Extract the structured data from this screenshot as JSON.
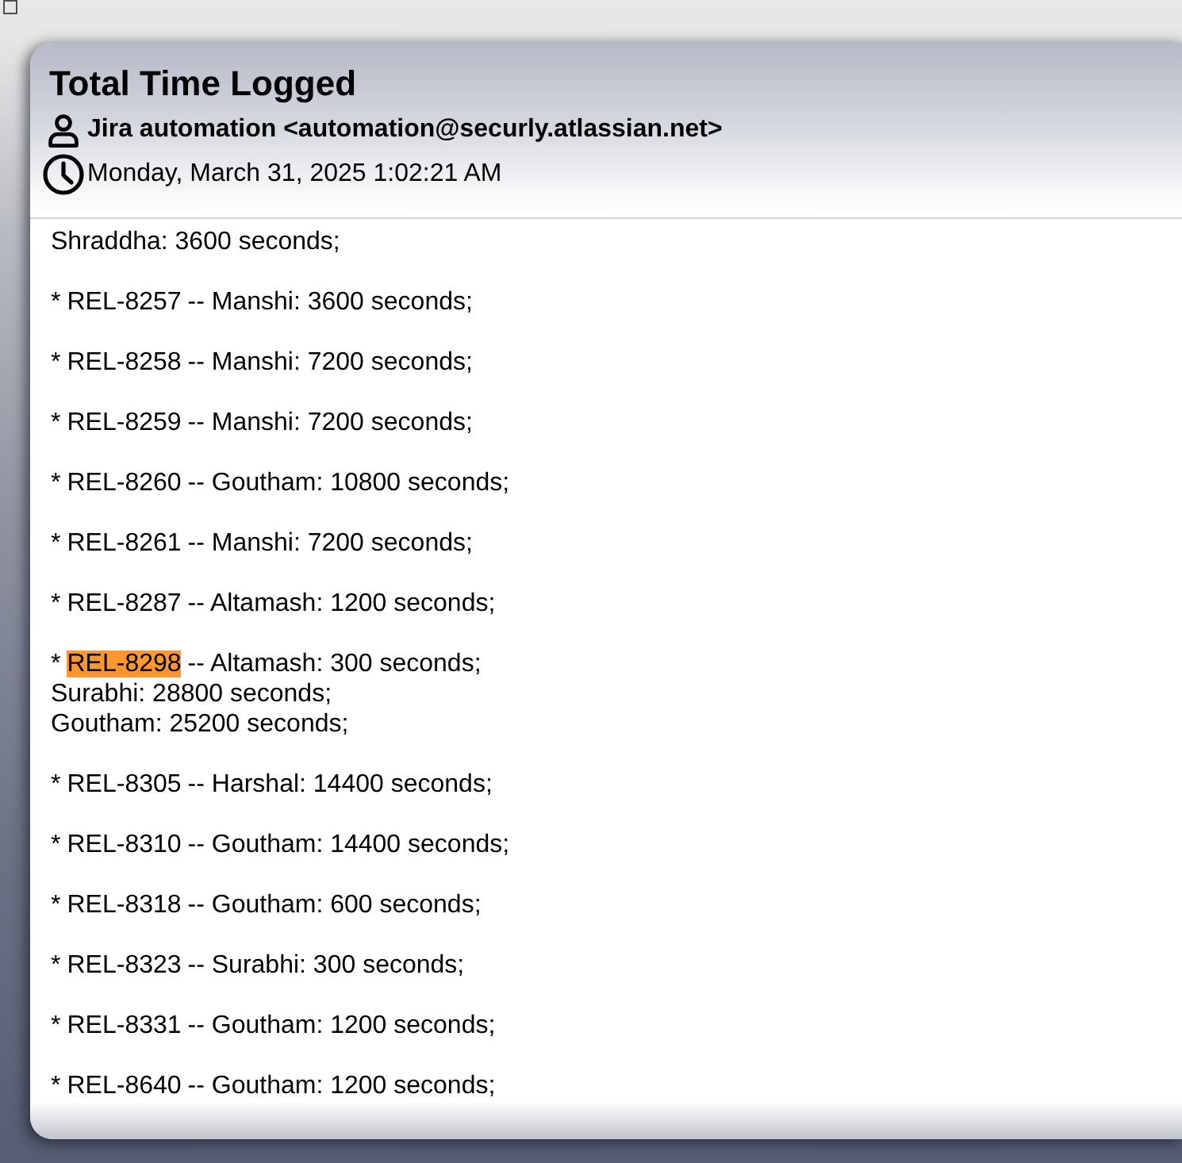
{
  "window": {
    "title": "Total Time Logged"
  },
  "sender": "Jira automation <automation@securly.atlassian.net>",
  "date": "Monday, March 31, 2025 1:02:21 AM",
  "entries": [
    {
      "kind": "continuation",
      "lines": [
        "Shraddha: 3600 seconds;"
      ]
    },
    {
      "kind": "entry",
      "bullet": "*",
      "issue": "REL-8257",
      "highlighted": false,
      "detail": "-- Manshi: 3600 seconds;"
    },
    {
      "kind": "entry",
      "bullet": "*",
      "issue": "REL-8258",
      "highlighted": false,
      "detail": "-- Manshi: 7200 seconds;"
    },
    {
      "kind": "entry",
      "bullet": "*",
      "issue": "REL-8259",
      "highlighted": false,
      "detail": "-- Manshi: 7200 seconds;"
    },
    {
      "kind": "entry",
      "bullet": "*",
      "issue": "REL-8260",
      "highlighted": false,
      "detail": "-- Goutham: 10800 seconds;"
    },
    {
      "kind": "entry",
      "bullet": "*",
      "issue": "REL-8261",
      "highlighted": false,
      "detail": "-- Manshi: 7200 seconds;"
    },
    {
      "kind": "entry",
      "bullet": "*",
      "issue": "REL-8287",
      "highlighted": false,
      "detail": "-- Altamash: 1200 seconds;"
    },
    {
      "kind": "entry",
      "bullet": "*",
      "issue": "REL-8298",
      "highlighted": true,
      "detail": "-- Altamash: 300 seconds;",
      "more": [
        "Surabhi: 28800 seconds;",
        "Goutham: 25200 seconds;"
      ]
    },
    {
      "kind": "entry",
      "bullet": "*",
      "issue": "REL-8305",
      "highlighted": false,
      "detail": "-- Harshal: 14400 seconds;"
    },
    {
      "kind": "entry",
      "bullet": "*",
      "issue": "REL-8310",
      "highlighted": false,
      "detail": "-- Goutham: 14400 seconds;"
    },
    {
      "kind": "entry",
      "bullet": "*",
      "issue": "REL-8318",
      "highlighted": false,
      "detail": "-- Goutham: 600 seconds;"
    },
    {
      "kind": "entry",
      "bullet": "*",
      "issue": "REL-8323",
      "highlighted": false,
      "detail": "-- Surabhi: 300 seconds;"
    },
    {
      "kind": "entry",
      "bullet": "*",
      "issue": "REL-8331",
      "highlighted": false,
      "detail": "-- Goutham: 1200 seconds;"
    },
    {
      "kind": "entry",
      "bullet": "*",
      "issue": "REL-8640",
      "highlighted": false,
      "detail": "-- Goutham: 1200 seconds;"
    }
  ]
}
